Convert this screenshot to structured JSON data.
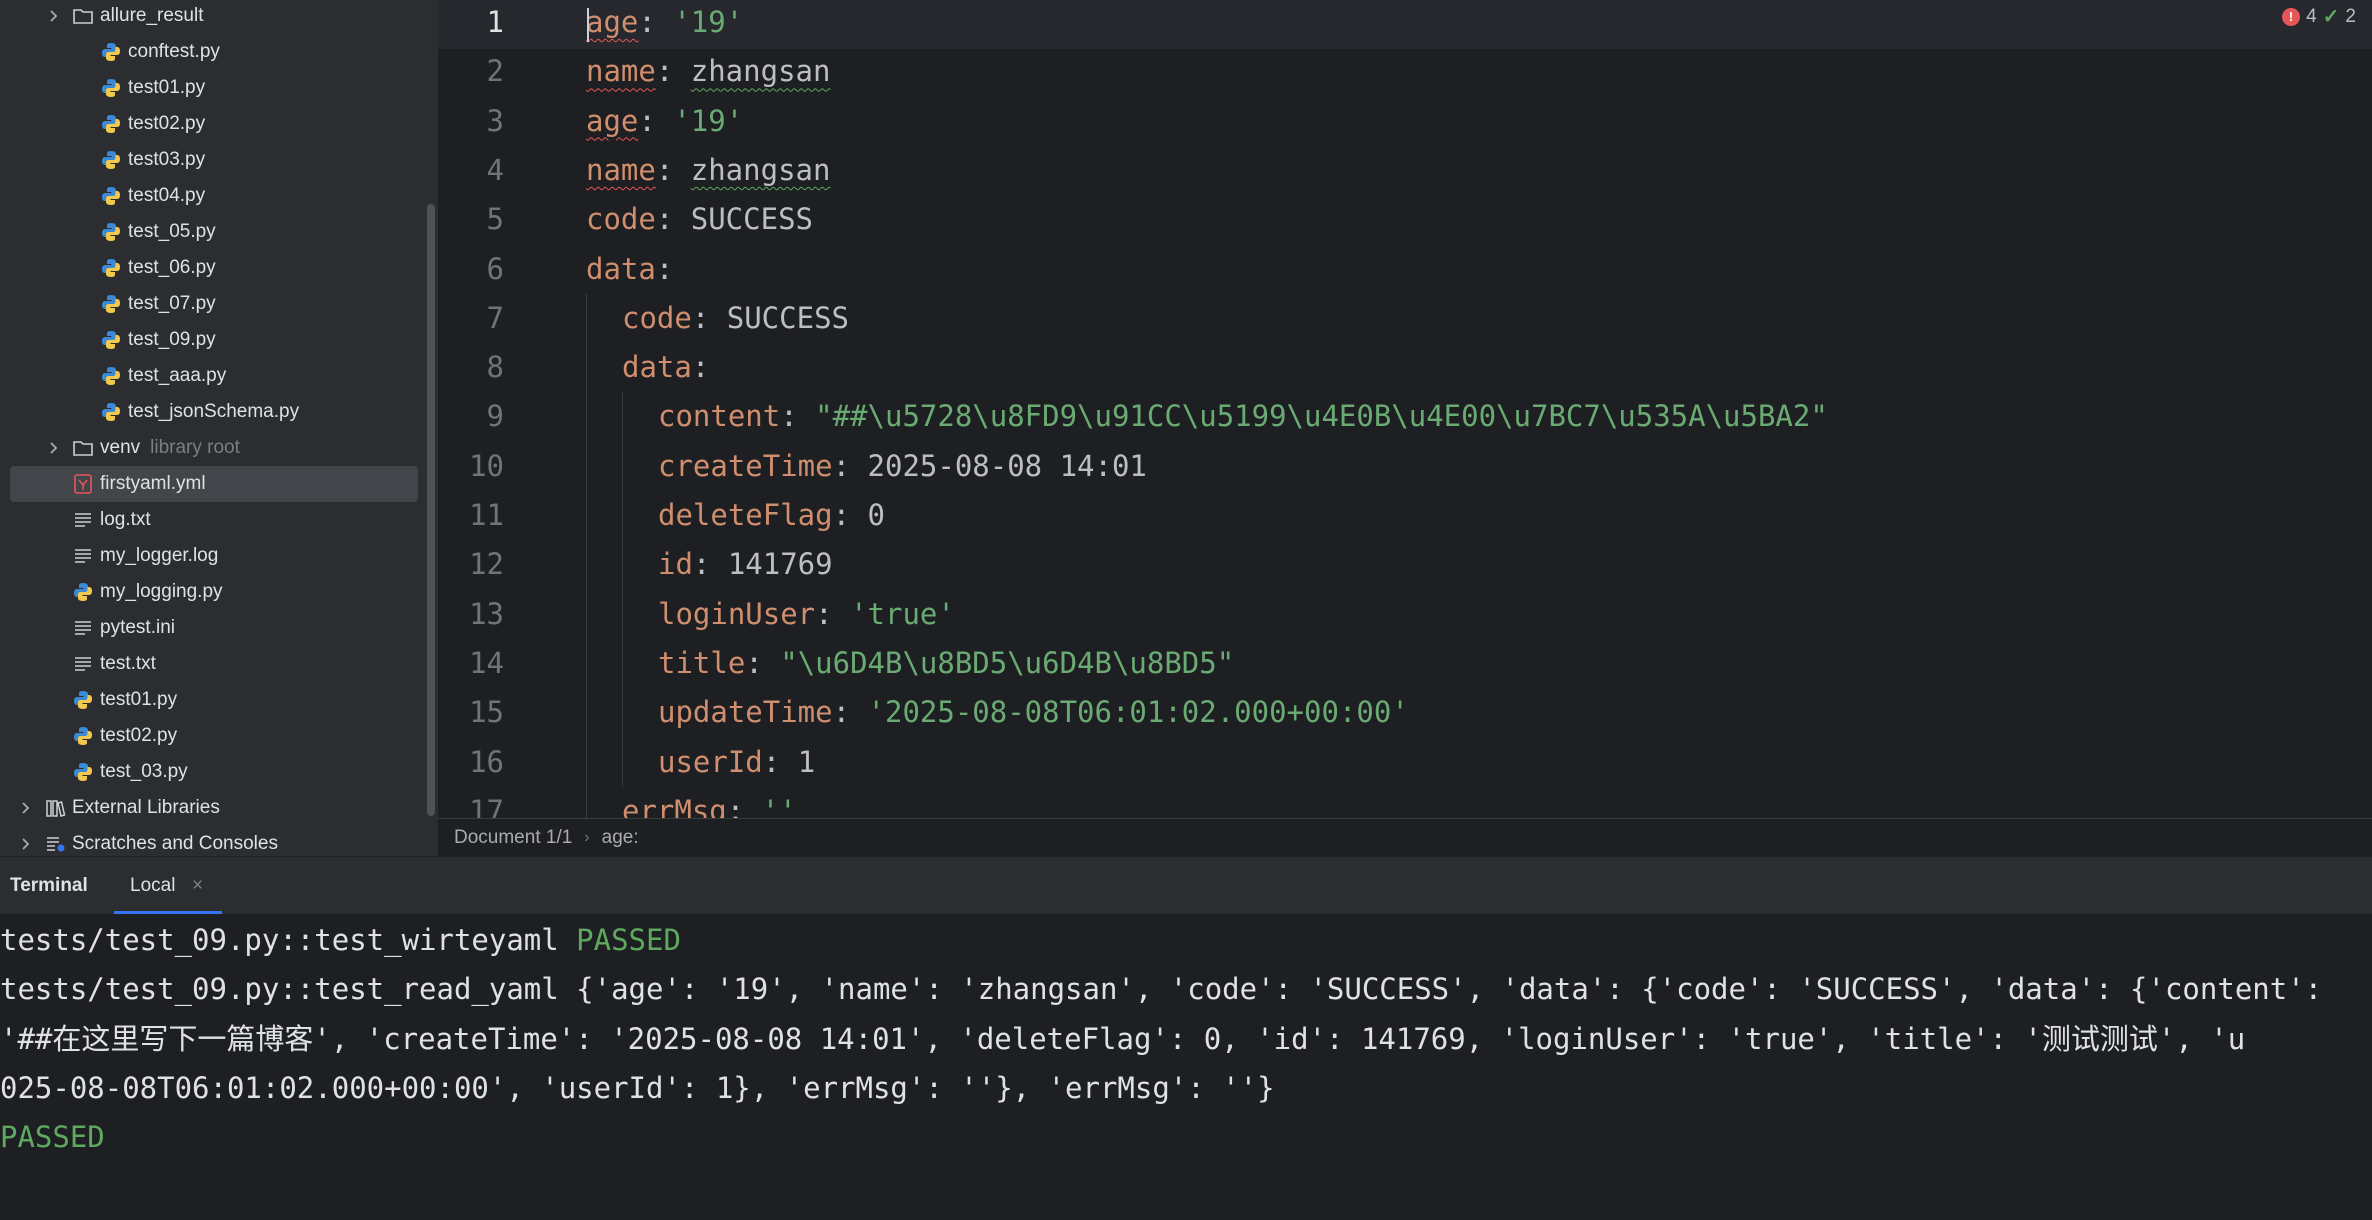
{
  "project_tree": {
    "items": [
      {
        "label": "allure_result",
        "kind": "folder",
        "indent": 1,
        "expandable": true
      },
      {
        "label": "conftest.py",
        "kind": "python",
        "indent": 2
      },
      {
        "label": "test01.py",
        "kind": "python",
        "indent": 2
      },
      {
        "label": "test02.py",
        "kind": "python",
        "indent": 2
      },
      {
        "label": "test03.py",
        "kind": "python",
        "indent": 2
      },
      {
        "label": "test04.py",
        "kind": "python",
        "indent": 2
      },
      {
        "label": "test_05.py",
        "kind": "python",
        "indent": 2
      },
      {
        "label": "test_06.py",
        "kind": "python",
        "indent": 2
      },
      {
        "label": "test_07.py",
        "kind": "python",
        "indent": 2
      },
      {
        "label": "test_09.py",
        "kind": "python",
        "indent": 2
      },
      {
        "label": "test_aaa.py",
        "kind": "python",
        "indent": 2
      },
      {
        "label": "test_jsonSchema.py",
        "kind": "python",
        "indent": 2
      },
      {
        "label": "venv",
        "sublabel": "library root",
        "kind": "folder",
        "indent": 1,
        "expandable": true
      },
      {
        "label": "firstyaml.yml",
        "kind": "yaml",
        "indent": 1,
        "selected": true
      },
      {
        "label": "log.txt",
        "kind": "text",
        "indent": 1
      },
      {
        "label": "my_logger.log",
        "kind": "text",
        "indent": 1
      },
      {
        "label": "my_logging.py",
        "kind": "python",
        "indent": 1
      },
      {
        "label": "pytest.ini",
        "kind": "text",
        "indent": 1
      },
      {
        "label": "test.txt",
        "kind": "text",
        "indent": 1
      },
      {
        "label": "test01.py",
        "kind": "python",
        "indent": 1
      },
      {
        "label": "test02.py",
        "kind": "python",
        "indent": 1
      },
      {
        "label": "test_03.py",
        "kind": "python",
        "indent": 1
      },
      {
        "label": "External Libraries",
        "kind": "library",
        "indent": 0,
        "expandable": true
      },
      {
        "label": "Scratches and Consoles",
        "kind": "scratch",
        "indent": 0,
        "expandable": true
      }
    ]
  },
  "editor": {
    "current_line": 1,
    "inspections": {
      "errors": "4",
      "ok": "2"
    },
    "lines": [
      {
        "n": "1",
        "indent": 0,
        "tokens": [
          [
            "k",
            "age",
            "r"
          ],
          [
            "p",
            ": "
          ],
          [
            "s",
            "'19'"
          ]
        ]
      },
      {
        "n": "2",
        "indent": 0,
        "tokens": [
          [
            "k",
            "name",
            "r"
          ],
          [
            "p",
            ": "
          ],
          [
            "v",
            "zhangsan",
            "g"
          ]
        ]
      },
      {
        "n": "3",
        "indent": 0,
        "tokens": [
          [
            "k",
            "age",
            "r"
          ],
          [
            "p",
            ": "
          ],
          [
            "s",
            "'19'"
          ]
        ]
      },
      {
        "n": "4",
        "indent": 0,
        "tokens": [
          [
            "k",
            "name",
            "r"
          ],
          [
            "p",
            ": "
          ],
          [
            "v",
            "zhangsan",
            "g"
          ]
        ]
      },
      {
        "n": "5",
        "indent": 0,
        "tokens": [
          [
            "k",
            "code"
          ],
          [
            "p",
            ": "
          ],
          [
            "v",
            "SUCCESS"
          ]
        ]
      },
      {
        "n": "6",
        "indent": 0,
        "tokens": [
          [
            "k",
            "data"
          ],
          [
            "p",
            ":"
          ]
        ]
      },
      {
        "n": "7",
        "indent": 1,
        "tokens": [
          [
            "k",
            "code"
          ],
          [
            "p",
            ": "
          ],
          [
            "v",
            "SUCCESS"
          ]
        ]
      },
      {
        "n": "8",
        "indent": 1,
        "tokens": [
          [
            "k",
            "data"
          ],
          [
            "p",
            ":"
          ]
        ]
      },
      {
        "n": "9",
        "indent": 2,
        "tokens": [
          [
            "k",
            "content"
          ],
          [
            "p",
            ": "
          ],
          [
            "s",
            "\"##\\u5728\\u8FD9\\u91CC\\u5199\\u4E0B\\u4E00\\u7BC7\\u535A\\u5BA2\""
          ]
        ]
      },
      {
        "n": "10",
        "indent": 2,
        "tokens": [
          [
            "k",
            "createTime"
          ],
          [
            "p",
            ": "
          ],
          [
            "v",
            "2025-08-08 14:01"
          ]
        ]
      },
      {
        "n": "11",
        "indent": 2,
        "tokens": [
          [
            "k",
            "deleteFlag"
          ],
          [
            "p",
            ": "
          ],
          [
            "v",
            "0"
          ]
        ]
      },
      {
        "n": "12",
        "indent": 2,
        "tokens": [
          [
            "k",
            "id"
          ],
          [
            "p",
            ": "
          ],
          [
            "v",
            "141769"
          ]
        ]
      },
      {
        "n": "13",
        "indent": 2,
        "tokens": [
          [
            "k",
            "loginUser"
          ],
          [
            "p",
            ": "
          ],
          [
            "s",
            "'true'"
          ]
        ]
      },
      {
        "n": "14",
        "indent": 2,
        "tokens": [
          [
            "k",
            "title"
          ],
          [
            "p",
            ": "
          ],
          [
            "s",
            "\"\\u6D4B\\u8BD5\\u6D4B\\u8BD5\""
          ]
        ]
      },
      {
        "n": "15",
        "indent": 2,
        "tokens": [
          [
            "k",
            "updateTime"
          ],
          [
            "p",
            ": "
          ],
          [
            "s",
            "'2025-08-08T06:01:02.000+00:00'"
          ]
        ]
      },
      {
        "n": "16",
        "indent": 2,
        "tokens": [
          [
            "k",
            "userId"
          ],
          [
            "p",
            ": "
          ],
          [
            "v",
            "1"
          ]
        ]
      },
      {
        "n": "17",
        "indent": 1,
        "tokens": [
          [
            "k",
            "errMsg"
          ],
          [
            "p",
            ": "
          ],
          [
            "s",
            "''"
          ]
        ]
      }
    ]
  },
  "breadcrumbs": {
    "document": "Document 1/1",
    "path": "age:"
  },
  "terminal": {
    "title": "Terminal",
    "tab_label": "Local",
    "tab_close": "×",
    "lines": [
      [
        [
          "t",
          "tests/test_09.py::test_wirteyaml "
        ],
        [
          "pass",
          "PASSED"
        ]
      ],
      [
        [
          "t",
          "tests/test_09.py::test_read_yaml {'age': '19', 'name': 'zhangsan', 'code': 'SUCCESS', 'data': {'code': 'SUCCESS', 'data': {'content':"
        ]
      ],
      [
        [
          "t",
          "'##在这里写下一篇博客', 'createTime': '2025-08-08 14:01', 'deleteFlag': 0, 'id': 141769, 'loginUser': 'true', 'title': '测试测试', 'u"
        ]
      ],
      [
        [
          "t",
          "025-08-08T06:01:02.000+00:00', 'userId': 1}, 'errMsg': ''}, 'errMsg': ''}"
        ]
      ],
      [
        [
          "pass",
          "PASSED"
        ]
      ]
    ]
  },
  "colors": {
    "background": "#1e1f22",
    "panel": "#2b2d30",
    "keyword": "#cf8e6d",
    "string": "#6aab73",
    "passed": "#5fa85f",
    "accent": "#3574f0"
  }
}
